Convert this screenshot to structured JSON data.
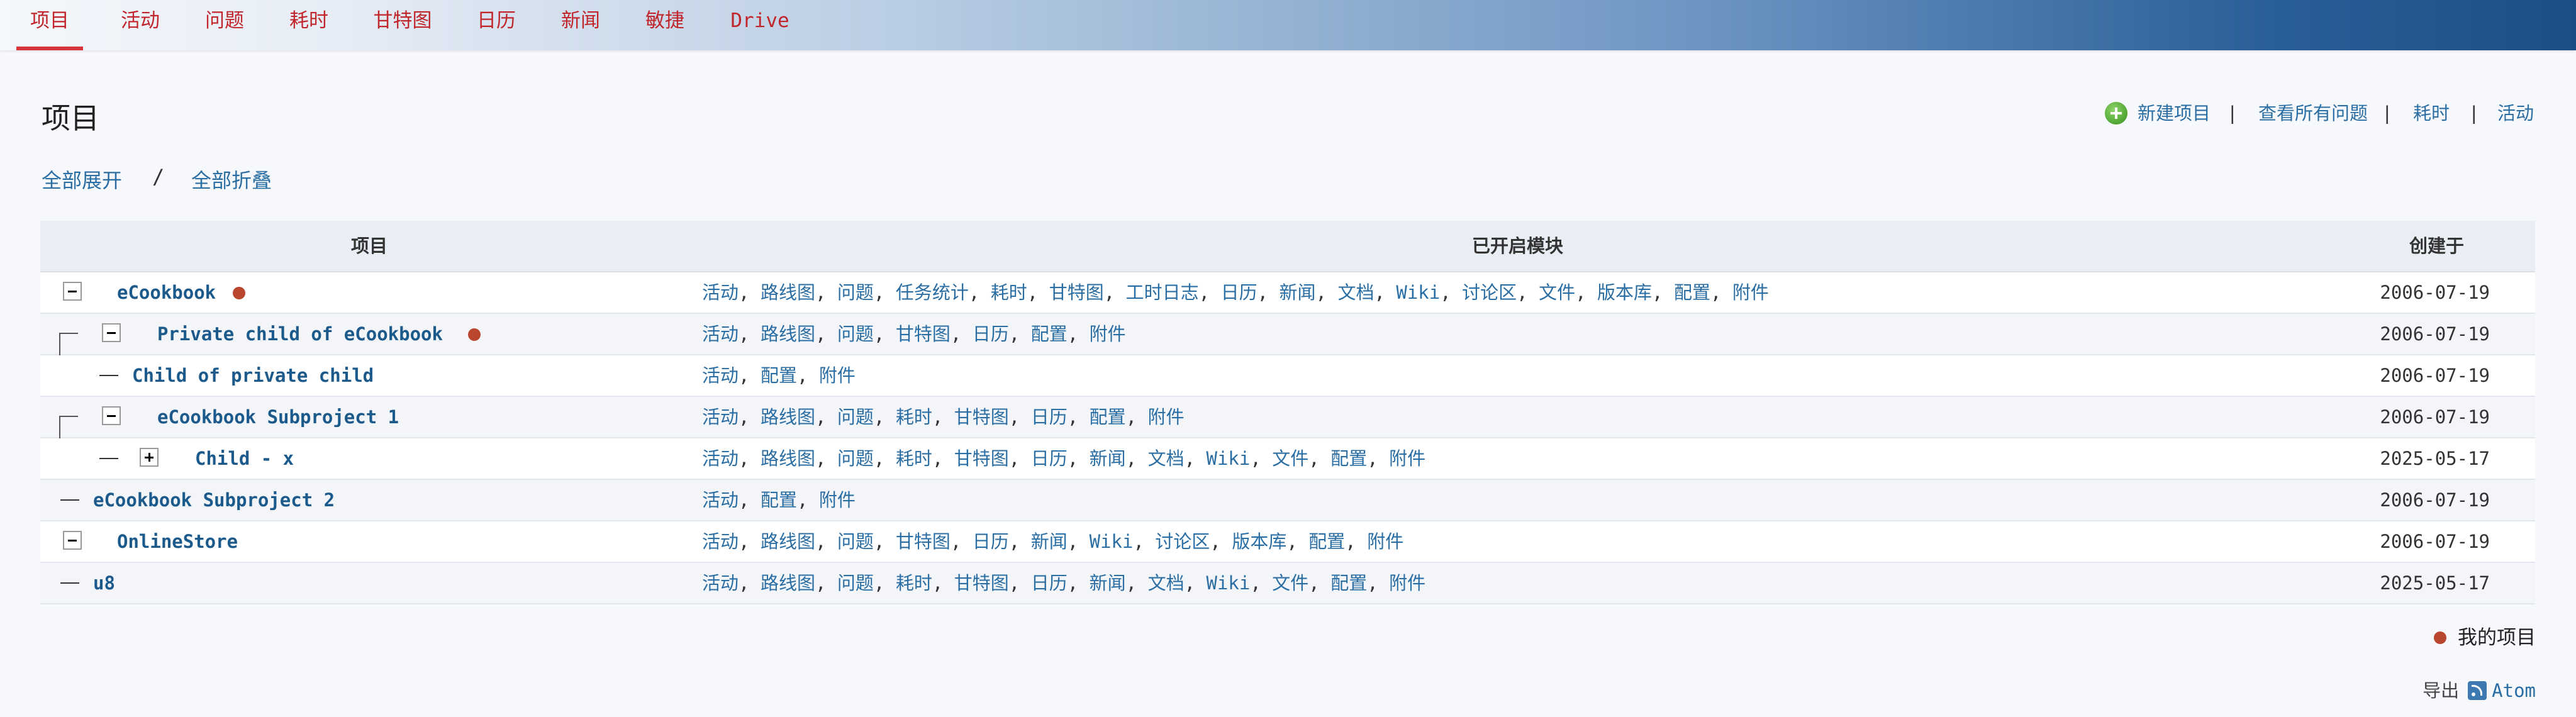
{
  "menu": {
    "items": [
      "项目",
      "活动",
      "问题",
      "耗时",
      "甘特图",
      "日历",
      "新闻",
      "敏捷",
      "Drive"
    ],
    "selected": "项目"
  },
  "page": {
    "title": "项目",
    "expand_all": "全部展开",
    "collapse_all": "全部折叠",
    "separator": "/"
  },
  "contextual": {
    "new_project": "新建项目",
    "view_all_issues": "查看所有问题",
    "spent_time": "耗时",
    "activity": "活动",
    "separator": "|"
  },
  "table": {
    "headers": {
      "project": "项目",
      "modules": "已开启模块",
      "created": "创建于"
    },
    "rows": [
      {
        "name": "eCookbook",
        "my_project": true,
        "toggle": "collapse",
        "modules": [
          "活动",
          "路线图",
          "问题",
          "任务统计",
          "耗时",
          "甘特图",
          "工时日志",
          "日历",
          "新闻",
          "文档",
          "Wiki",
          "讨论区",
          "文件",
          "版本库",
          "配置",
          "附件"
        ],
        "created": "2006-07-19"
      },
      {
        "name": "Private child of eCookbook",
        "my_project": true,
        "toggle": "collapse",
        "modules": [
          "活动",
          "路线图",
          "问题",
          "甘特图",
          "日历",
          "配置",
          "附件"
        ],
        "created": "2006-07-19"
      },
      {
        "name": "Child of private child",
        "my_project": false,
        "toggle": "none",
        "modules": [
          "活动",
          "配置",
          "附件"
        ],
        "created": "2006-07-19"
      },
      {
        "name": "eCookbook Subproject 1",
        "my_project": false,
        "toggle": "collapse",
        "modules": [
          "活动",
          "路线图",
          "问题",
          "耗时",
          "甘特图",
          "日历",
          "配置",
          "附件"
        ],
        "created": "2006-07-19"
      },
      {
        "name": "Child - x",
        "my_project": false,
        "toggle": "expand",
        "modules": [
          "活动",
          "路线图",
          "问题",
          "耗时",
          "甘特图",
          "日历",
          "新闻",
          "文档",
          "Wiki",
          "文件",
          "配置",
          "附件"
        ],
        "created": "2025-05-17"
      },
      {
        "name": "eCookbook Subproject 2",
        "my_project": false,
        "toggle": "none",
        "modules": [
          "活动",
          "配置",
          "附件"
        ],
        "created": "2006-07-19"
      },
      {
        "name": "OnlineStore",
        "my_project": false,
        "toggle": "collapse",
        "modules": [
          "活动",
          "路线图",
          "问题",
          "甘特图",
          "日历",
          "新闻",
          "Wiki",
          "讨论区",
          "版本库",
          "配置",
          "附件"
        ],
        "created": "2006-07-19"
      },
      {
        "name": "u8",
        "my_project": false,
        "toggle": "none",
        "modules": [
          "活动",
          "路线图",
          "问题",
          "耗时",
          "甘特图",
          "日历",
          "新闻",
          "文档",
          "Wiki",
          "文件",
          "配置",
          "附件"
        ],
        "created": "2025-05-17"
      }
    ]
  },
  "legend": {
    "my_projects": "我的项目"
  },
  "export": {
    "label": "导出",
    "atom": "Atom"
  },
  "icons": {
    "add": "add-icon",
    "my_project": "my-project-dot-icon",
    "feed": "feed-icon",
    "toggle_collapse": "collapse-icon",
    "toggle_expand": "expand-icon"
  },
  "colors": {
    "menu_text": "#c0262b",
    "link": "#2b6ea3",
    "project_link": "#1d5a8c",
    "my_project_dot": "#b9472f"
  }
}
